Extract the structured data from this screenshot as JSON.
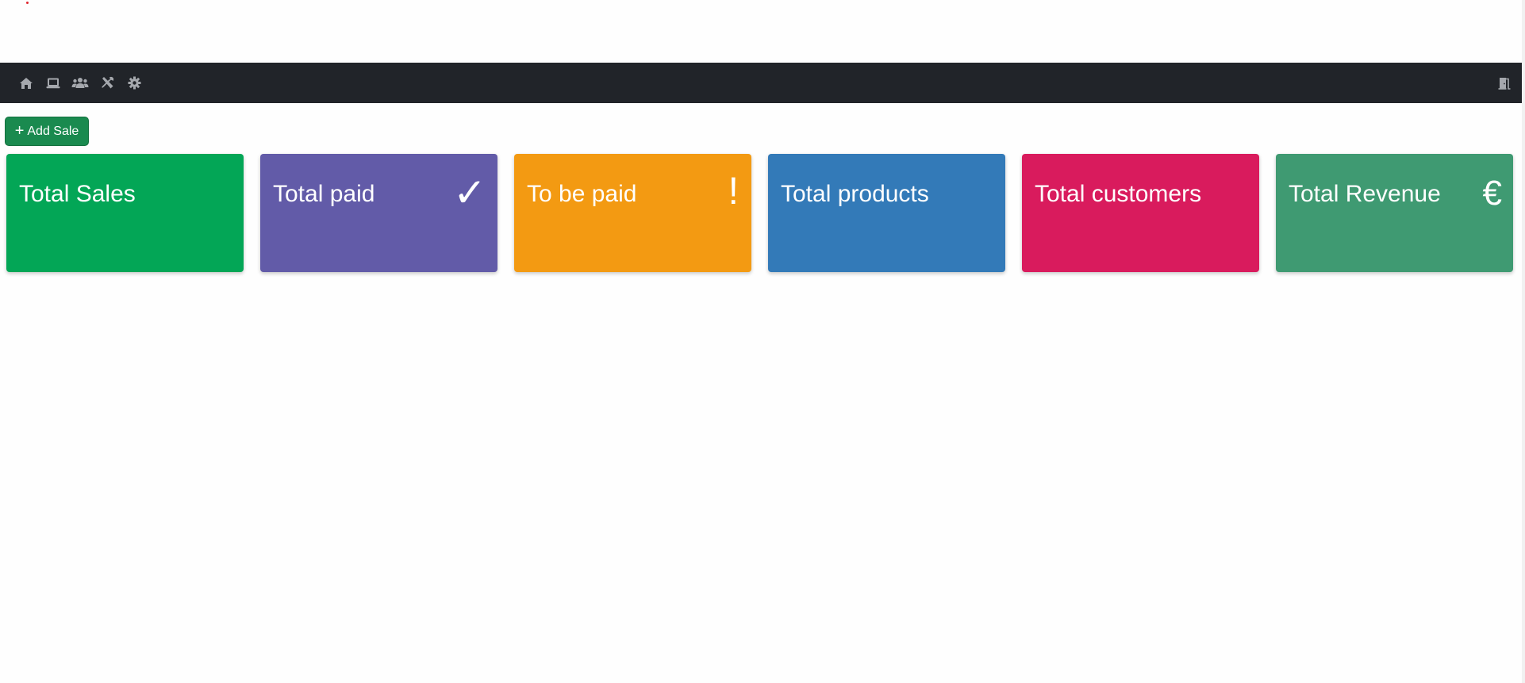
{
  "navbar": {
    "icons": [
      "home-icon",
      "laptop-icon",
      "users-icon",
      "tools-icon",
      "gear-icon"
    ],
    "right_icon": "door-exit-icon",
    "background": "#212429",
    "icon_color": "#a5a8ad"
  },
  "actions": {
    "add_sale_label": "Add Sale",
    "add_sale_icon": "plus-icon",
    "add_sale_color": "#1a8a4f"
  },
  "cards": [
    {
      "title": "Total Sales",
      "icon": "",
      "color": "#03a656"
    },
    {
      "title": "Total paid",
      "icon": "✓",
      "color": "#625ba8"
    },
    {
      "title": "To be paid",
      "icon": "!",
      "color": "#f39a12"
    },
    {
      "title": "Total products",
      "icon": "",
      "color": "#337ab8"
    },
    {
      "title": "Total customers",
      "icon": "",
      "color": "#d91b5d"
    },
    {
      "title": "Total Revenue",
      "icon": "€",
      "color": "#3f9a72"
    }
  ]
}
